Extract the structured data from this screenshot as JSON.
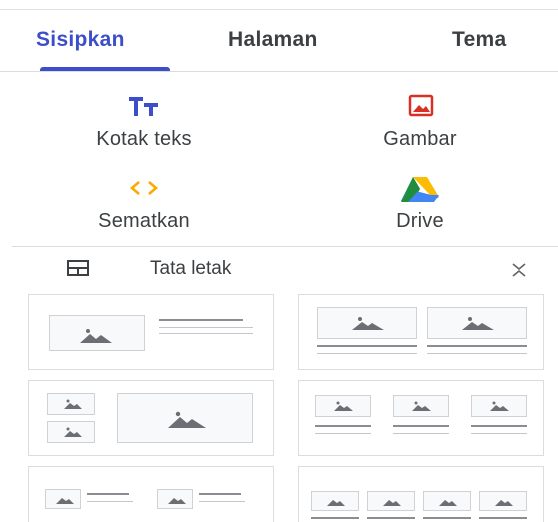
{
  "tabs": [
    {
      "label": "Sisipkan",
      "active": true
    },
    {
      "label": "Halaman",
      "active": false
    },
    {
      "label": "Tema",
      "active": false
    }
  ],
  "insert_items": [
    {
      "label": "Kotak teks",
      "icon": "text-box-icon",
      "color": "#3c4ec9"
    },
    {
      "label": "Gambar",
      "icon": "image-icon",
      "color": "#d93025"
    },
    {
      "label": "Sematkan",
      "icon": "embed-icon",
      "color": "#f9ab00"
    },
    {
      "label": "Drive",
      "icon": "google-drive-icon",
      "color": "#1e8e3e"
    }
  ],
  "layout_section": {
    "title": "Tata letak",
    "icon": "layout-icon",
    "collapse_icon": "collapse-icon"
  },
  "colors": {
    "accent": "#3c4ec9",
    "text": "#3c4043",
    "border": "#dadce0"
  }
}
